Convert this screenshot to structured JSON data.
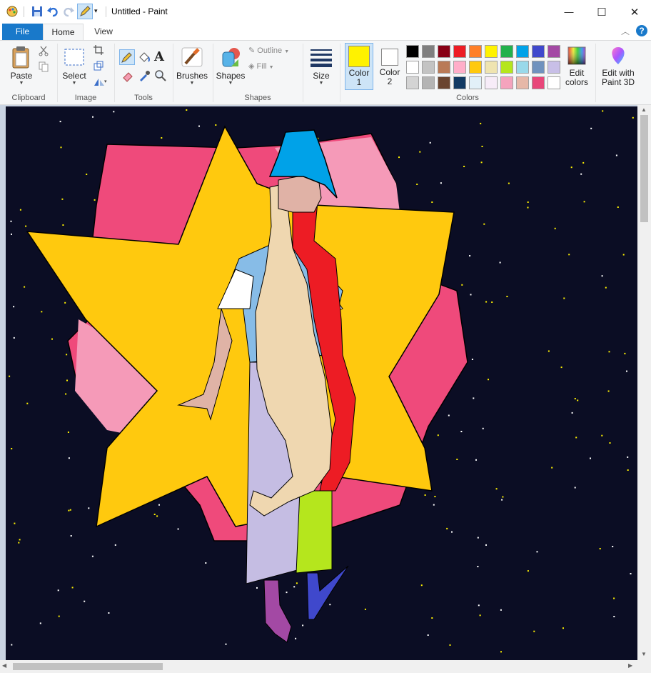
{
  "window": {
    "title": "Untitled - Paint",
    "minimize_glyph": "—",
    "maximize_glyph": "☐",
    "close_glyph": "✕"
  },
  "tabs": {
    "file": "File",
    "home": "Home",
    "view": "View"
  },
  "ribbon": {
    "clipboard": {
      "label": "Clipboard",
      "paste": "Paste"
    },
    "image": {
      "label": "Image",
      "select": "Select"
    },
    "tools": {
      "label": "Tools"
    },
    "brushes": {
      "label": "Brushes"
    },
    "shapes": {
      "label": "Shapes",
      "shapes_btn": "Shapes",
      "outline": "Outline",
      "fill": "Fill"
    },
    "size": {
      "label": "Size"
    },
    "colors": {
      "label": "Colors",
      "color1_line1": "Color",
      "color1_line2": "1",
      "color2_line1": "Color",
      "color2_line2": "2",
      "edit_line1": "Edit",
      "edit_line2": "colors",
      "color1": "#fff200",
      "color2": "#ffffff",
      "palette": [
        "#000000",
        "#7f7f7f",
        "#880015",
        "#ed1c24",
        "#ff7f27",
        "#fff200",
        "#22b14c",
        "#00a2e8",
        "#3f48cc",
        "#a349a4",
        "#ffffff",
        "#c3c3c3",
        "#b97a57",
        "#ffaec9",
        "#ffc90e",
        "#efe4b0",
        "#b5e61d",
        "#99d9ea",
        "#7092be",
        "#c8bfe7",
        "#d4d4d4",
        "#b4b4b4",
        "#6a4530",
        "#123a63",
        "#e2f0f8",
        "#f7ecf8",
        "#f4a3bd",
        "#e6b8a8",
        "#e8477a",
        "#0d1022"
      ],
      "last_cell": "#ffffff"
    },
    "paint3d": {
      "line1": "Edit with",
      "line2": "Paint 3D"
    }
  },
  "canvas": {
    "background": "#0b0d24"
  }
}
